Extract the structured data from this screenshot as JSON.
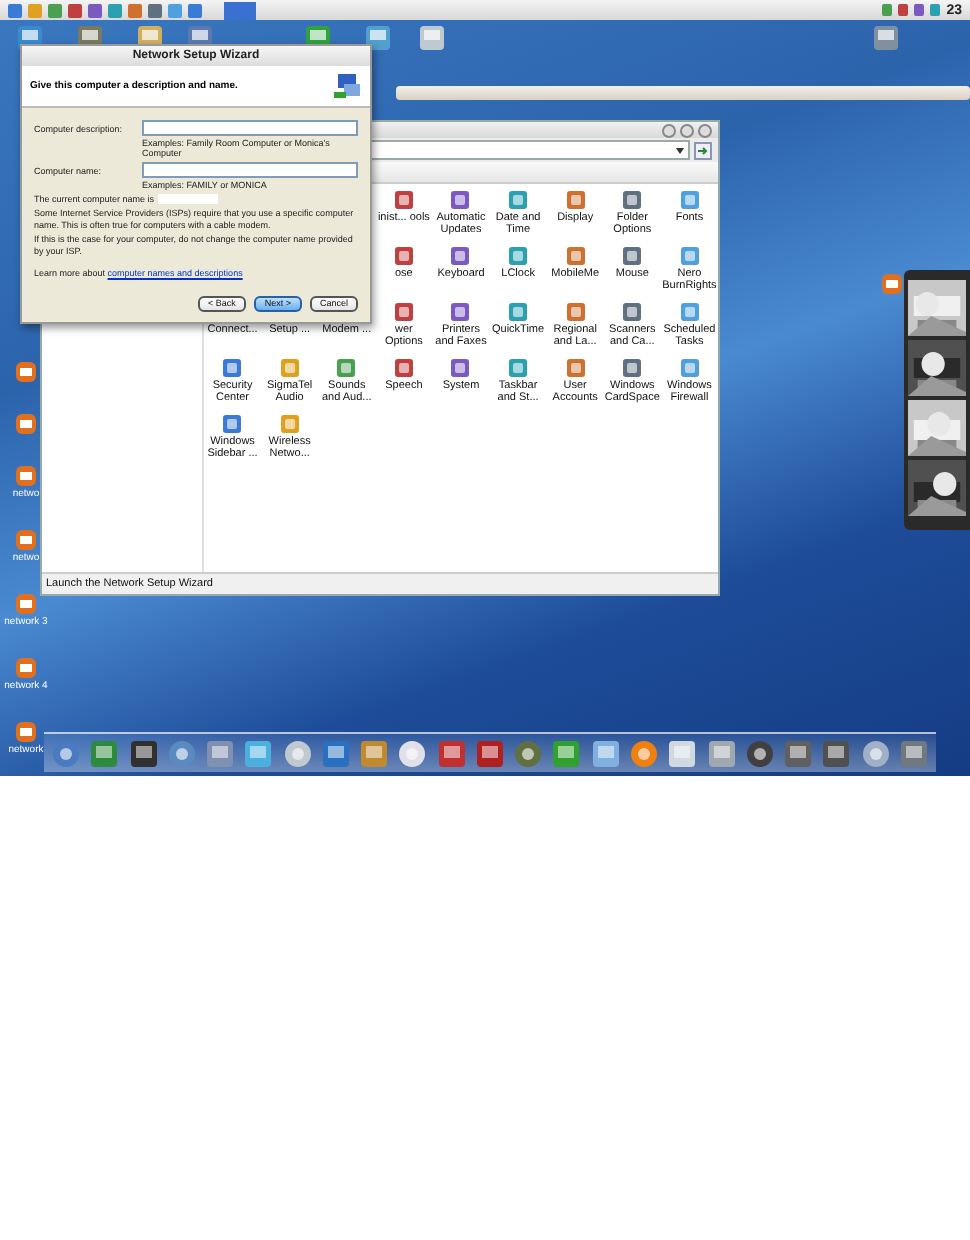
{
  "menubar": {
    "clock": "23"
  },
  "desktop_icons": [
    {
      "label": "netwo"
    },
    {
      "label": "netwo"
    },
    {
      "label": "network 3"
    },
    {
      "label": "network 4"
    },
    {
      "label": "network"
    }
  ],
  "control_panel": {
    "items": [
      {
        "kind": "covered"
      },
      {
        "kind": "covered"
      },
      {
        "kind": "covered"
      },
      {
        "kind": "cut",
        "label": "inist... ools"
      },
      {
        "kind": "full",
        "label": "Automatic Updates"
      },
      {
        "kind": "full",
        "label": "Date and Time"
      },
      {
        "kind": "full",
        "label": "Display"
      },
      {
        "kind": "full",
        "label": "Folder Options"
      },
      {
        "kind": "full",
        "label": "Fonts"
      },
      {
        "kind": "covered"
      },
      {
        "kind": "covered"
      },
      {
        "kind": "covered"
      },
      {
        "kind": "cut",
        "label": "ose"
      },
      {
        "kind": "full",
        "label": "Keyboard"
      },
      {
        "kind": "full",
        "label": "LClock"
      },
      {
        "kind": "full",
        "label": "MobileMe"
      },
      {
        "kind": "full",
        "label": "Mouse"
      },
      {
        "kind": "full",
        "label": "Nero BurnRights"
      },
      {
        "kind": "label",
        "label": "Connect..."
      },
      {
        "kind": "label",
        "label": "Setup ..."
      },
      {
        "kind": "label",
        "label": "Modem ..."
      },
      {
        "kind": "cut",
        "label": "wer Options"
      },
      {
        "kind": "full",
        "label": "Printers and Faxes"
      },
      {
        "kind": "full",
        "label": "QuickTime"
      },
      {
        "kind": "full",
        "label": "Regional and La..."
      },
      {
        "kind": "full",
        "label": "Scanners and Ca..."
      },
      {
        "kind": "full",
        "label": "Scheduled Tasks"
      },
      {
        "kind": "full",
        "label": "Security Center"
      },
      {
        "kind": "full",
        "label": "SigmaTel Audio"
      },
      {
        "kind": "full",
        "label": "Sounds and Aud..."
      },
      {
        "kind": "full",
        "label": "Speech"
      },
      {
        "kind": "full",
        "label": "System"
      },
      {
        "kind": "full",
        "label": "Taskbar and St..."
      },
      {
        "kind": "full",
        "label": "User Accounts"
      },
      {
        "kind": "full",
        "label": "Windows CardSpace"
      },
      {
        "kind": "full",
        "label": "Windows Firewall"
      },
      {
        "kind": "full",
        "label": "Windows Sidebar ..."
      },
      {
        "kind": "full",
        "label": "Wireless Netwo..."
      }
    ],
    "status": "Launch the Network Setup Wizard"
  },
  "wizard": {
    "title": "Network Setup Wizard",
    "heading": "Give this computer a description and name.",
    "fields": [
      {
        "label": "Computer description:",
        "hint": "Examples: Family Room Computer or Monica's Computer"
      },
      {
        "label": "Computer name:",
        "hint": "Examples: FAMILY or MONICA"
      }
    ],
    "current_name": "The current computer name is",
    "paragraphs": [
      "Some Internet Service Providers (ISPs) require that you use a specific computer name. This is often true for computers with a cable modem.",
      "If this is the case for your computer, do not change the computer name provided by your ISP."
    ],
    "learn_more": "Learn more about",
    "link": "computer names and descriptions",
    "buttons": [
      {
        "label": "< Back",
        "selected": false
      },
      {
        "label": "Next >",
        "selected": true
      },
      {
        "label": "Cancel",
        "selected": false
      }
    ]
  }
}
